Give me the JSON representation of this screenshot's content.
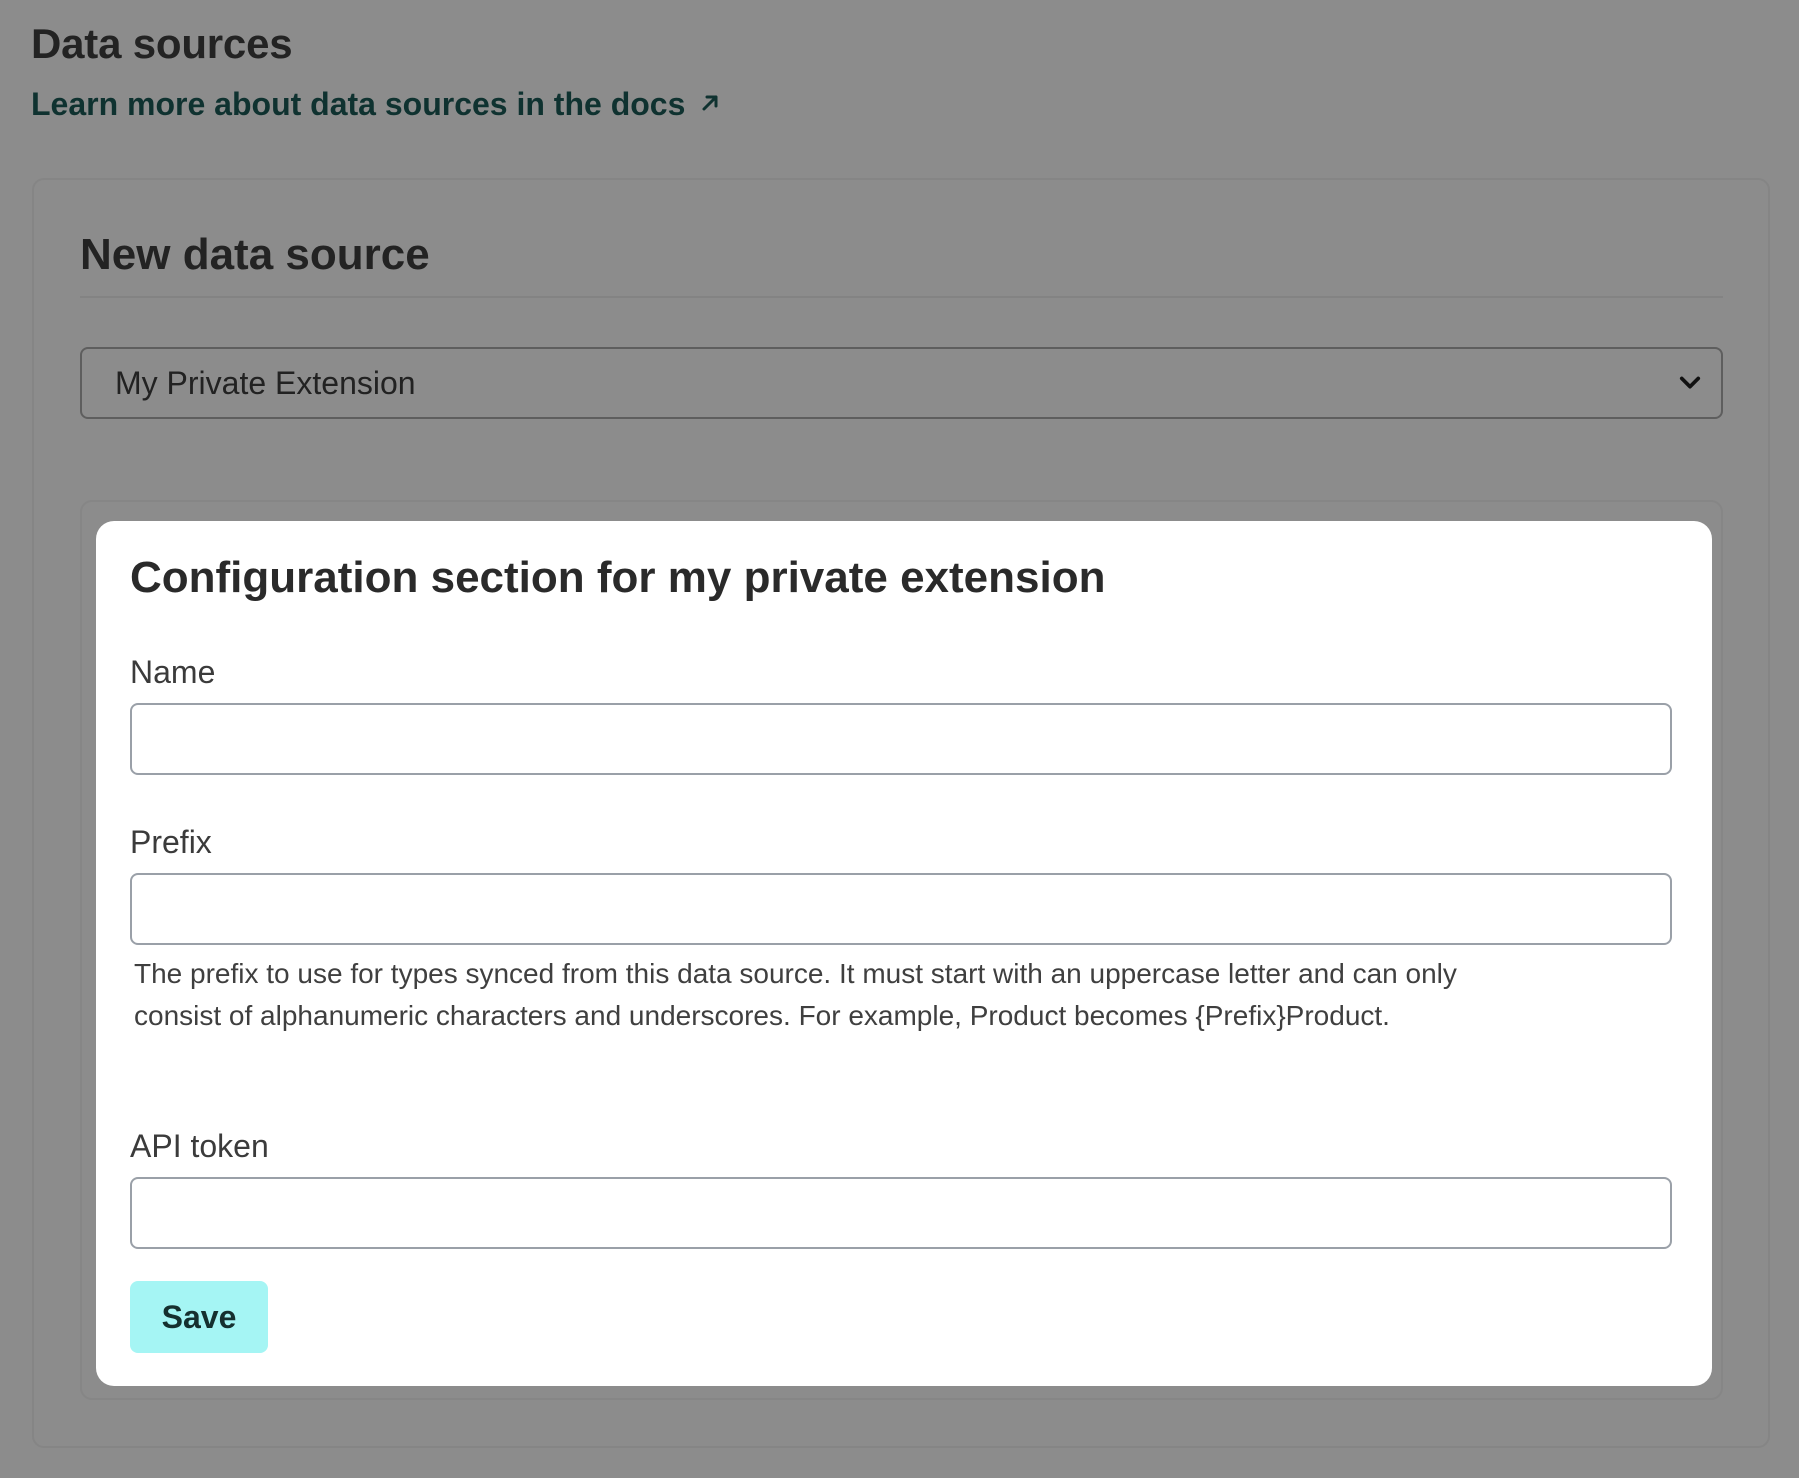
{
  "header": {
    "title": "Data sources",
    "docs_link": "Learn more about data sources in the docs",
    "docs_link_icon": "external-arrow-icon"
  },
  "new_data_source": {
    "title": "New data source",
    "selected_option": "My Private Extension",
    "select_icon": "chevron-down-icon"
  },
  "config": {
    "title": "Configuration section for my private extension",
    "fields": {
      "name": {
        "label": "Name",
        "value": "",
        "placeholder": ""
      },
      "prefix": {
        "label": "Prefix",
        "value": "",
        "placeholder": "",
        "help": "The prefix to use for types synced from this data source. It must start with an uppercase letter and can only consist of alphanumeric characters and underscores. For example, Product becomes {Prefix}Product."
      },
      "api_token": {
        "label": "API token",
        "value": "",
        "placeholder": ""
      }
    },
    "save_label": "Save"
  },
  "colors": {
    "overlay_background": "#8c8c8c",
    "panel_background": "#ffffff",
    "save_button": "#a5f5f4",
    "link": "#0f3230"
  }
}
